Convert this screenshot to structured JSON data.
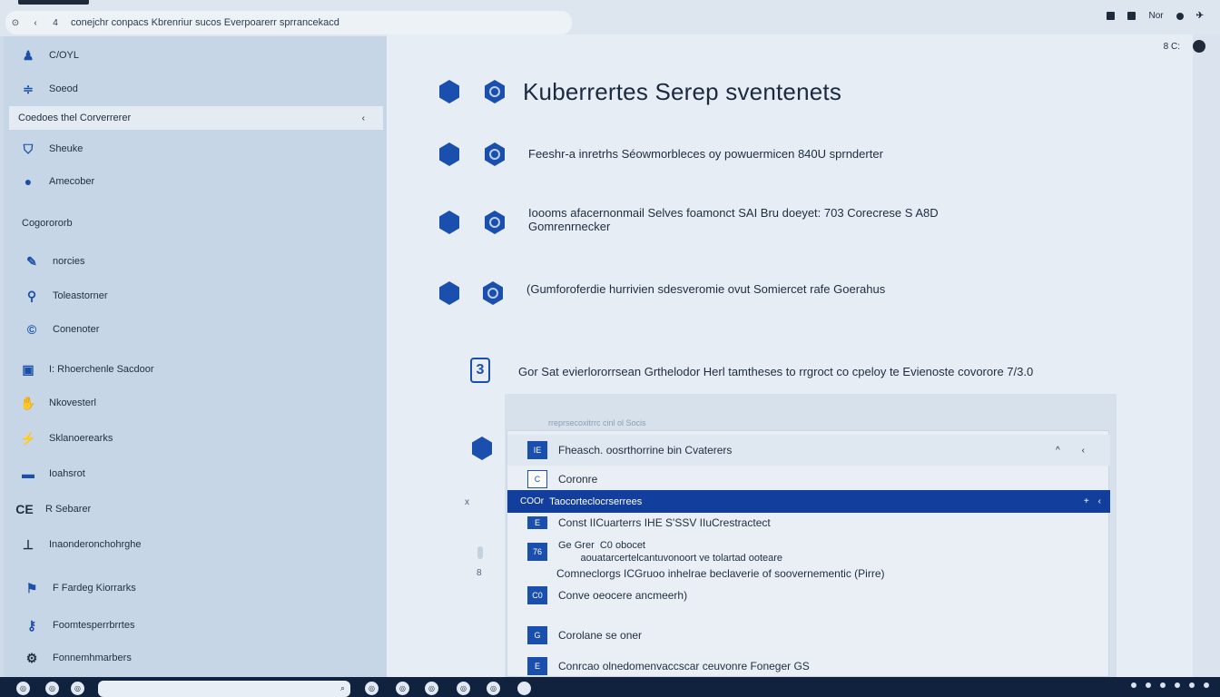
{
  "browser": {
    "controls": [
      "⊙",
      "‹",
      "4"
    ],
    "url": "conejchr conpacs Kbrenriur sucos Everpoarerr sprrancekacd"
  },
  "topRight": {
    "text": "Nor"
  },
  "railRight": {
    "text": "8 C:"
  },
  "sidebar": {
    "items": [
      {
        "label": "C/OYL",
        "icon": "person-icon",
        "glyph": "♟"
      },
      {
        "label": "Soeod",
        "icon": "sliders-icon",
        "glyph": "≑"
      },
      {
        "label": "Sheuke",
        "icon": "shield-icon",
        "glyph": "⛉"
      },
      {
        "label": "Amecober",
        "icon": "globe-icon",
        "glyph": "●"
      },
      {
        "label": "norcies",
        "icon": "wrench-icon",
        "glyph": "✎"
      },
      {
        "label": "Toleastorner",
        "icon": "runner-icon",
        "glyph": "⚲"
      },
      {
        "label": "Conenoter",
        "icon": "circle-c-icon",
        "glyph": "©"
      },
      {
        "label": "I: Rhoerchenle Sacdoor",
        "icon": "box-icon",
        "glyph": "▣"
      },
      {
        "label": "Nkovesterl",
        "icon": "hand-icon",
        "glyph": "✋"
      },
      {
        "label": "Sklanoerearks",
        "icon": "plug-icon",
        "glyph": "⚡"
      },
      {
        "label": "Ioahsrot",
        "icon": "pill-icon",
        "glyph": "▬"
      },
      {
        "label": "R Sebarer",
        "icon": "ce-icon",
        "glyph": "CE"
      },
      {
        "label": "Inaonderonchohrghe",
        "icon": "terminal-icon",
        "glyph": "⊥"
      },
      {
        "label": "F Fardeg Kiorrarks",
        "icon": "flag-icon",
        "glyph": "⚑"
      },
      {
        "label": "Foomtesperrbrrtes",
        "icon": "key-icon",
        "glyph": "⚷"
      },
      {
        "label": "Fonnemhmarbers",
        "icon": "gear-icon",
        "glyph": "⚙"
      }
    ],
    "selected": {
      "label": "Coedoes thel Corverrerer",
      "chevron": "‹"
    },
    "heading": "Cogorororb"
  },
  "main": {
    "title": "Kuberrertes Serep sventenets",
    "rows": [
      "Feeshr-a  inretrhs  Séowmorbleces  oy  powuermicen 840U sprnderter",
      "Ioooms  afacernonmail  Selves  foamonct  SAI Bru  doeyet:  703 Corecrese S A8D\nGomrenrnecker",
      "(Gumforoferdie  hurrivien  sdesveromie  ovut  Somiercet  rafe  Goerahus",
      "Gor Sat  evierlororrsean  Grthelodor  Herl  tamtheses  to  rrgroct  co  cpeloy  te  Evienoste  covorore  7/3.0"
    ],
    "badge": "3"
  },
  "panel": {
    "caption": "rreprsecoxitrrc cinl ol Socis",
    "header": {
      "label": "Fheasch. oosrthorrine bin Cvaterers",
      "icons": [
        "^",
        "‹"
      ]
    },
    "rows": [
      {
        "icon": "C",
        "label": "Coronre"
      },
      {
        "icon": "COOr",
        "label": "Taocorteclocrserrees",
        "selected": true
      },
      {
        "icon": "E",
        "label": "Const IICuarterrs IHE S'SSV IIuCrestractect"
      },
      {
        "icon": "76",
        "label": "Ge Grer  C0 obocet\n        aouatarcertelcantuvonoort ve tolartad ooteare"
      },
      {
        "icon": "",
        "label": "Comneclorgs ICGruoo inhelrae beclaverie of soovernementic (Pirre)"
      },
      {
        "icon": "C0",
        "label": "Conve oeocere ancmeerh)"
      },
      {
        "icon": "G",
        "label": "Corolane se oner"
      },
      {
        "icon": "E",
        "label": "Conrcao olnedomenvaccscar  ceuvonre Foneger GS"
      }
    ],
    "selIcons": [
      "+",
      "‹"
    ],
    "gutter": [
      "x",
      "8"
    ]
  },
  "taskbar": {
    "icons": [
      "◎",
      "◎",
      "◎",
      "◎",
      "◎",
      "◎",
      "◎",
      "◎"
    ],
    "searchIcon": "⌕"
  }
}
